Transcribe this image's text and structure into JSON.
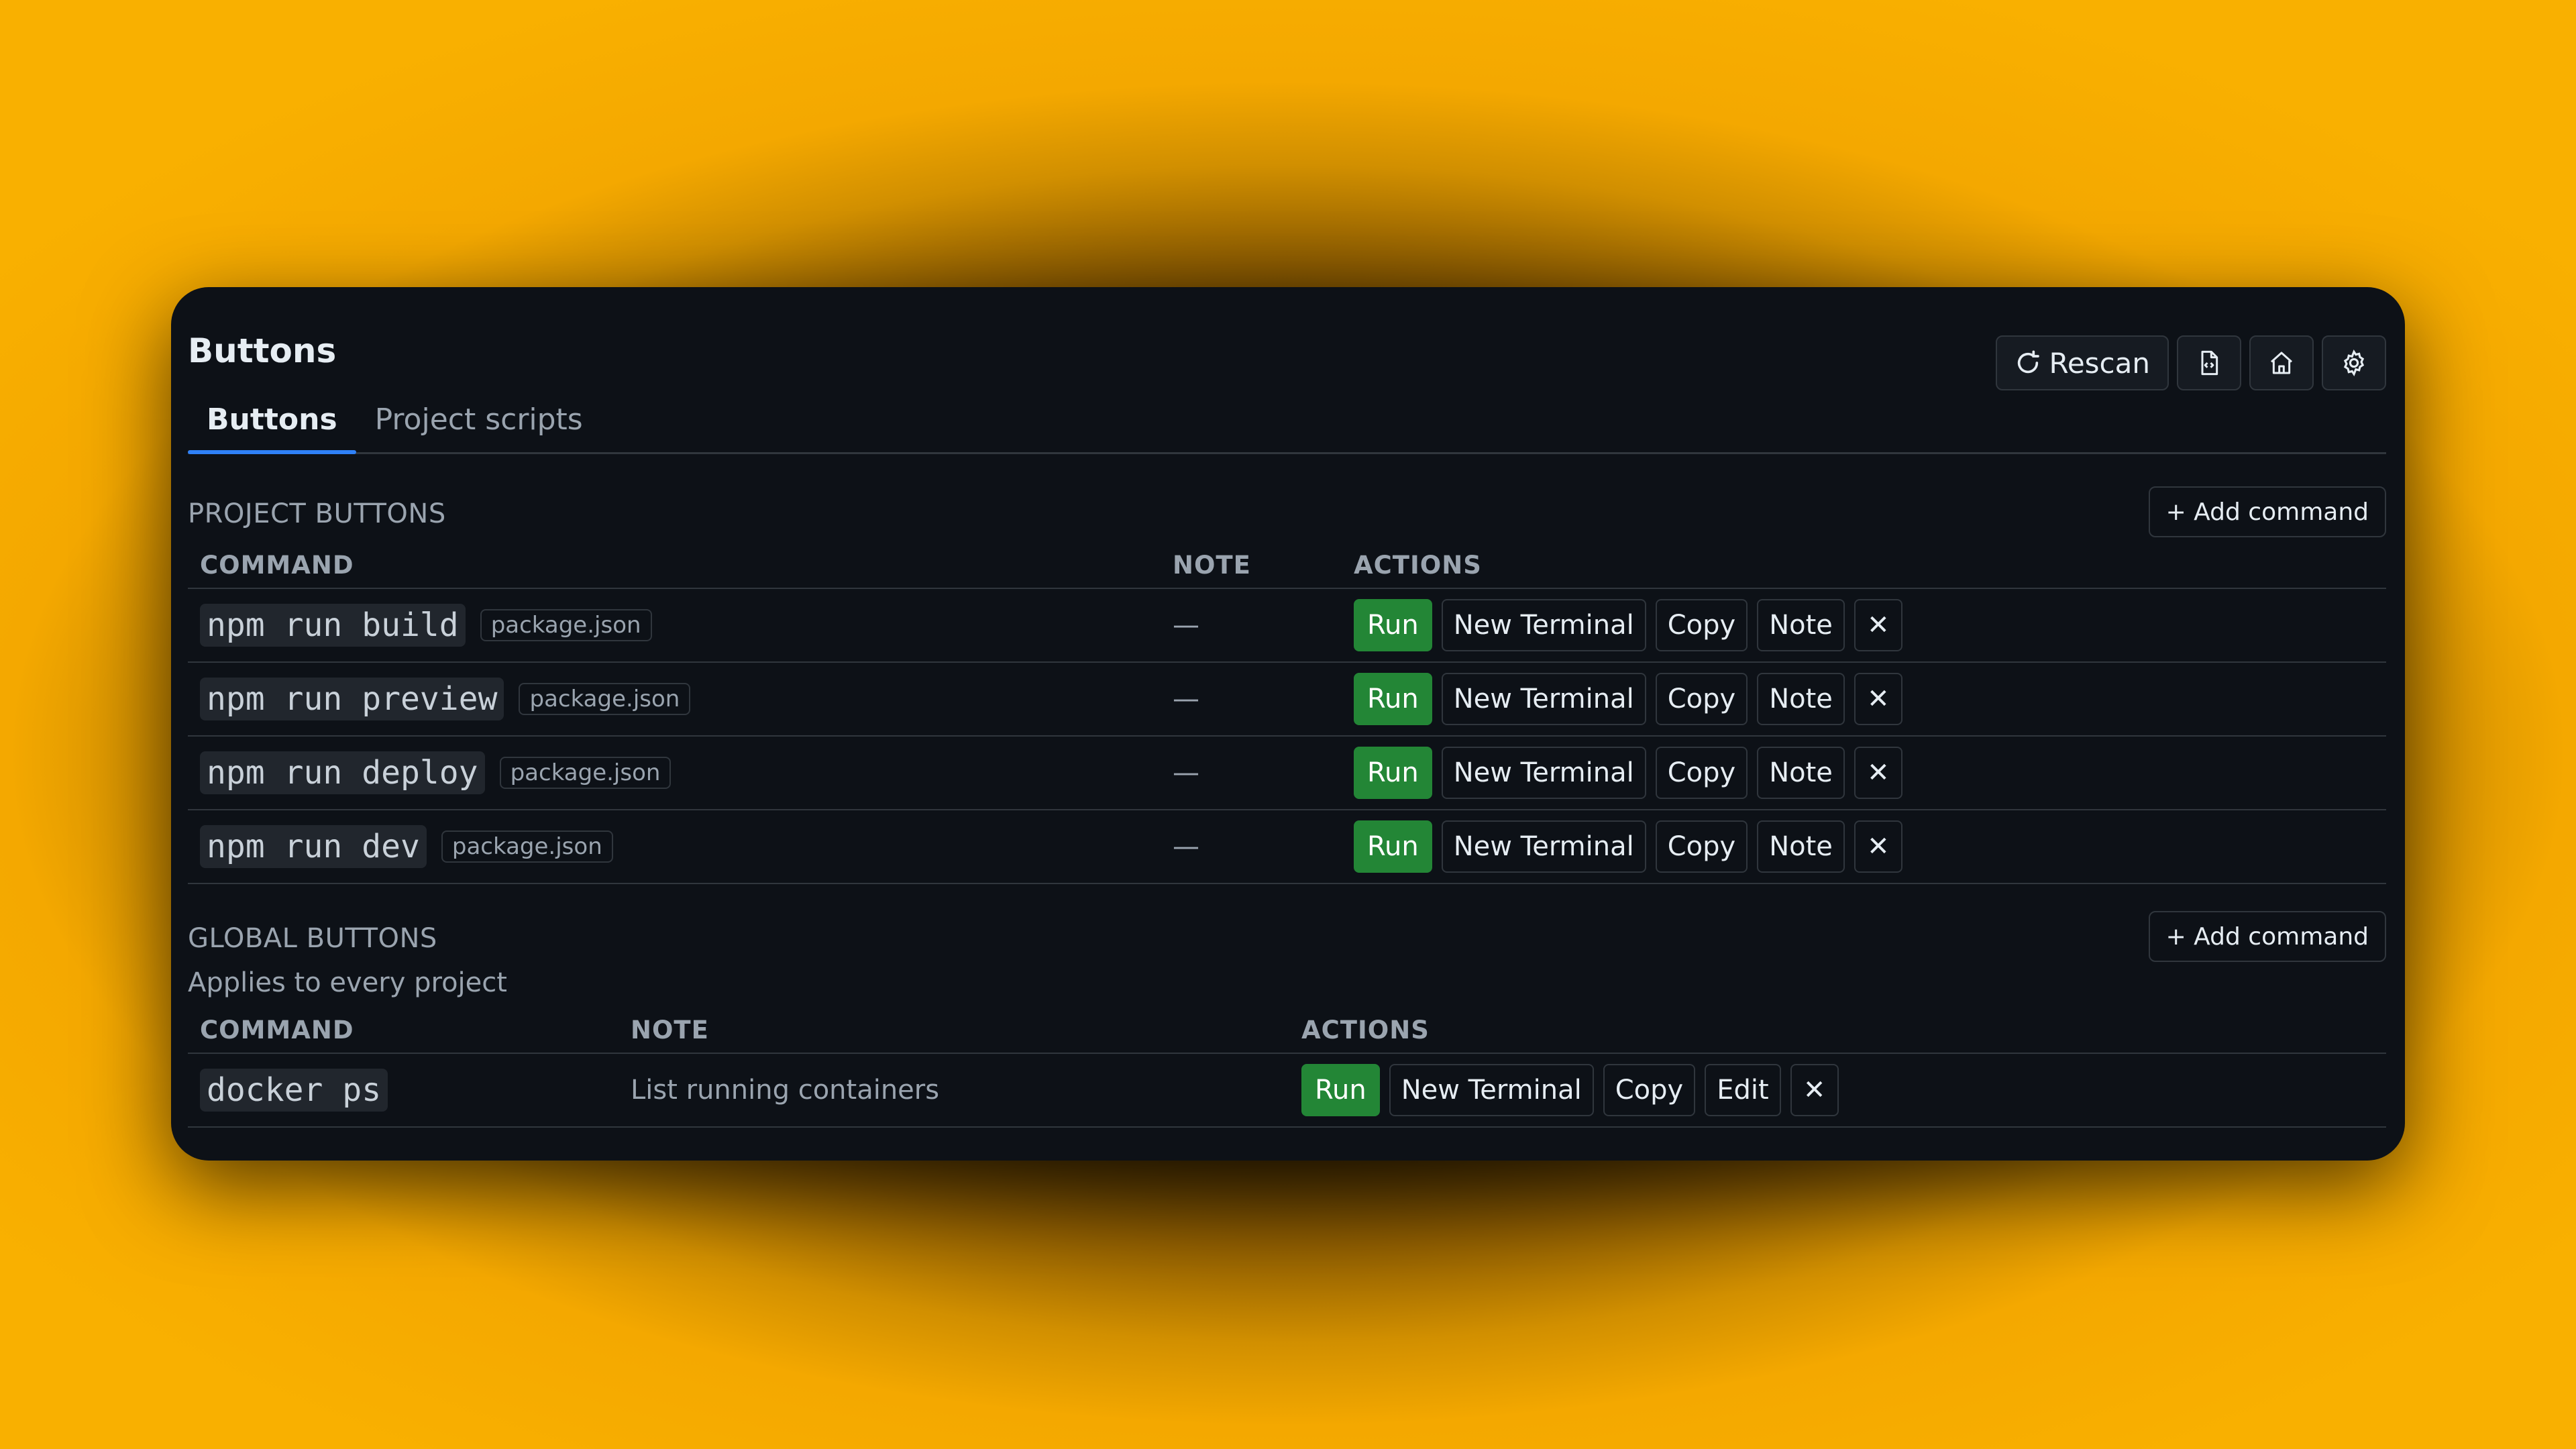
{
  "header": {
    "title": "Buttons",
    "rescan_label": "Rescan",
    "icons": [
      "rescan-icon",
      "file-code-icon",
      "home-icon",
      "gear-icon"
    ]
  },
  "tabs": [
    {
      "label": "Buttons",
      "active": true
    },
    {
      "label": "Project scripts",
      "active": false
    }
  ],
  "project": {
    "section_title": "PROJECT BUTTONS",
    "add_label": "+ Add command",
    "columns": {
      "command": "COMMAND",
      "note": "NOTE",
      "actions": "ACTIONS"
    },
    "rows": [
      {
        "command": "npm run build",
        "source": "package.json",
        "note": "—"
      },
      {
        "command": "npm run preview",
        "source": "package.json",
        "note": "—"
      },
      {
        "command": "npm run deploy",
        "source": "package.json",
        "note": "—"
      },
      {
        "command": "npm run dev",
        "source": "package.json",
        "note": "—"
      }
    ],
    "actions": {
      "run": "Run",
      "new_terminal": "New Terminal",
      "copy": "Copy",
      "note": "Note",
      "delete": "✕"
    }
  },
  "global": {
    "section_title": "GLOBAL BUTTONS",
    "subtitle": "Applies to every project",
    "add_label": "+ Add command",
    "columns": {
      "command": "COMMAND",
      "note": "NOTE",
      "actions": "ACTIONS"
    },
    "rows": [
      {
        "command": "docker ps",
        "note": "List running containers"
      }
    ],
    "actions": {
      "run": "Run",
      "new_terminal": "New Terminal",
      "copy": "Copy",
      "edit": "Edit",
      "delete": "✕"
    }
  },
  "colors": {
    "background_accent": "#f9b000",
    "panel": "#0d1117",
    "run_button": "#238636",
    "active_tab": "#2f81f7"
  }
}
